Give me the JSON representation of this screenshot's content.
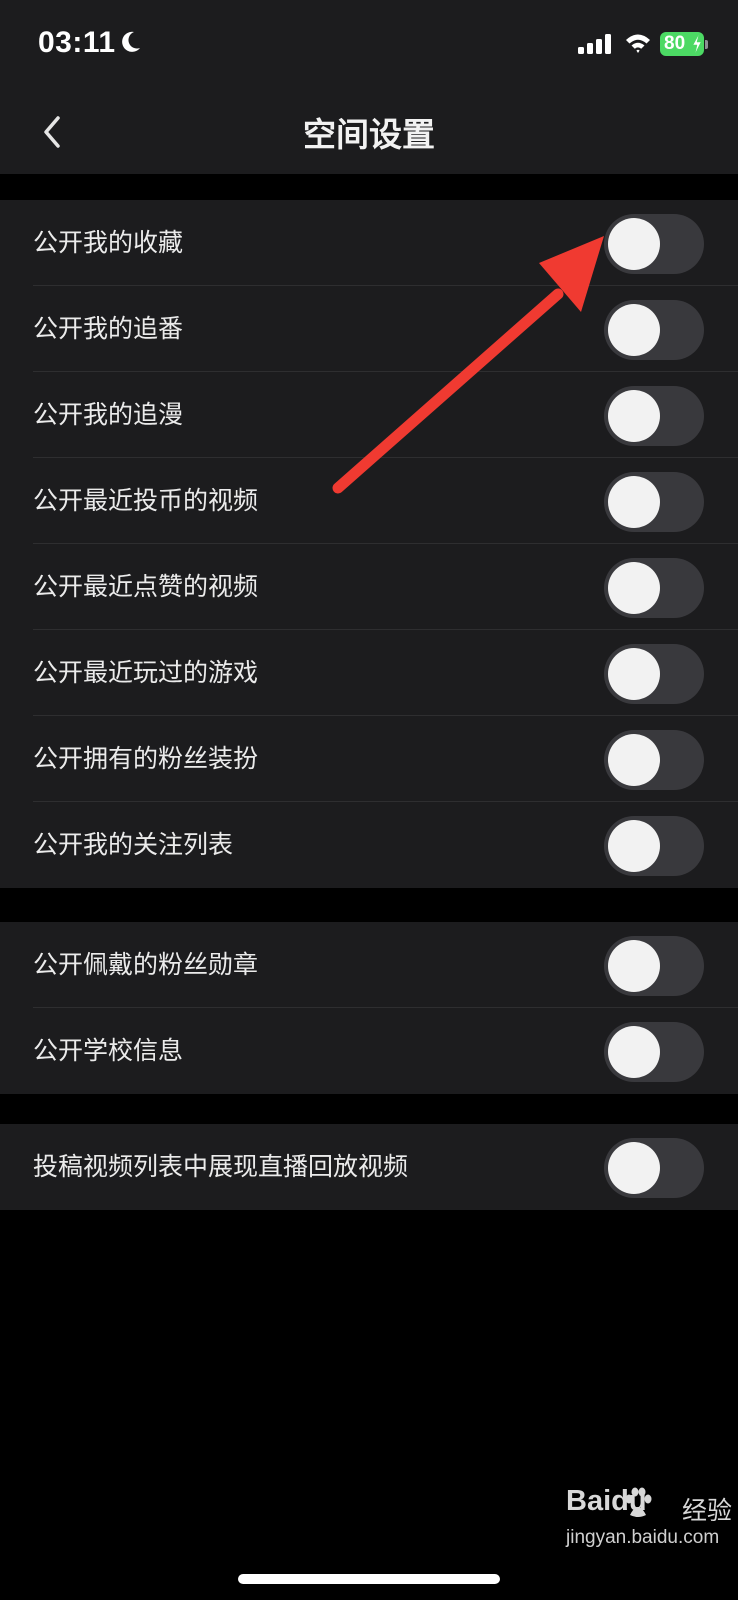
{
  "status_bar": {
    "time": "03:11",
    "battery": "80"
  },
  "nav": {
    "title": "空间设置"
  },
  "groups": [
    {
      "items": [
        {
          "label": "公开我的收藏",
          "enabled": false
        },
        {
          "label": "公开我的追番",
          "enabled": false
        },
        {
          "label": "公开我的追漫",
          "enabled": false
        },
        {
          "label": "公开最近投币的视频",
          "enabled": false
        },
        {
          "label": "公开最近点赞的视频",
          "enabled": false
        },
        {
          "label": "公开最近玩过的游戏",
          "enabled": false
        },
        {
          "label": "公开拥有的粉丝装扮",
          "enabled": false
        },
        {
          "label": "公开我的关注列表",
          "enabled": false
        }
      ]
    },
    {
      "items": [
        {
          "label": "公开佩戴的粉丝勋章",
          "enabled": false
        },
        {
          "label": "公开学校信息",
          "enabled": false
        }
      ]
    },
    {
      "items": [
        {
          "label": "投稿视频列表中展现直播回放视频",
          "enabled": false
        }
      ]
    }
  ],
  "watermark": {
    "brand": "Baidu",
    "product": "经验",
    "url": "jingyan.baidu.com"
  },
  "colors": {
    "background": "#000000",
    "surface": "#1c1c1e",
    "toggle_off": "#39393d",
    "knob": "#f2f2f2",
    "annotation_arrow": "#f03a31",
    "battery": "#4cd964"
  },
  "icons": [
    "moon-icon",
    "cellular-signal-icon",
    "wifi-icon",
    "battery-icon",
    "back-chevron-icon",
    "annotation-arrow-icon",
    "baidu-paw-icon"
  ]
}
